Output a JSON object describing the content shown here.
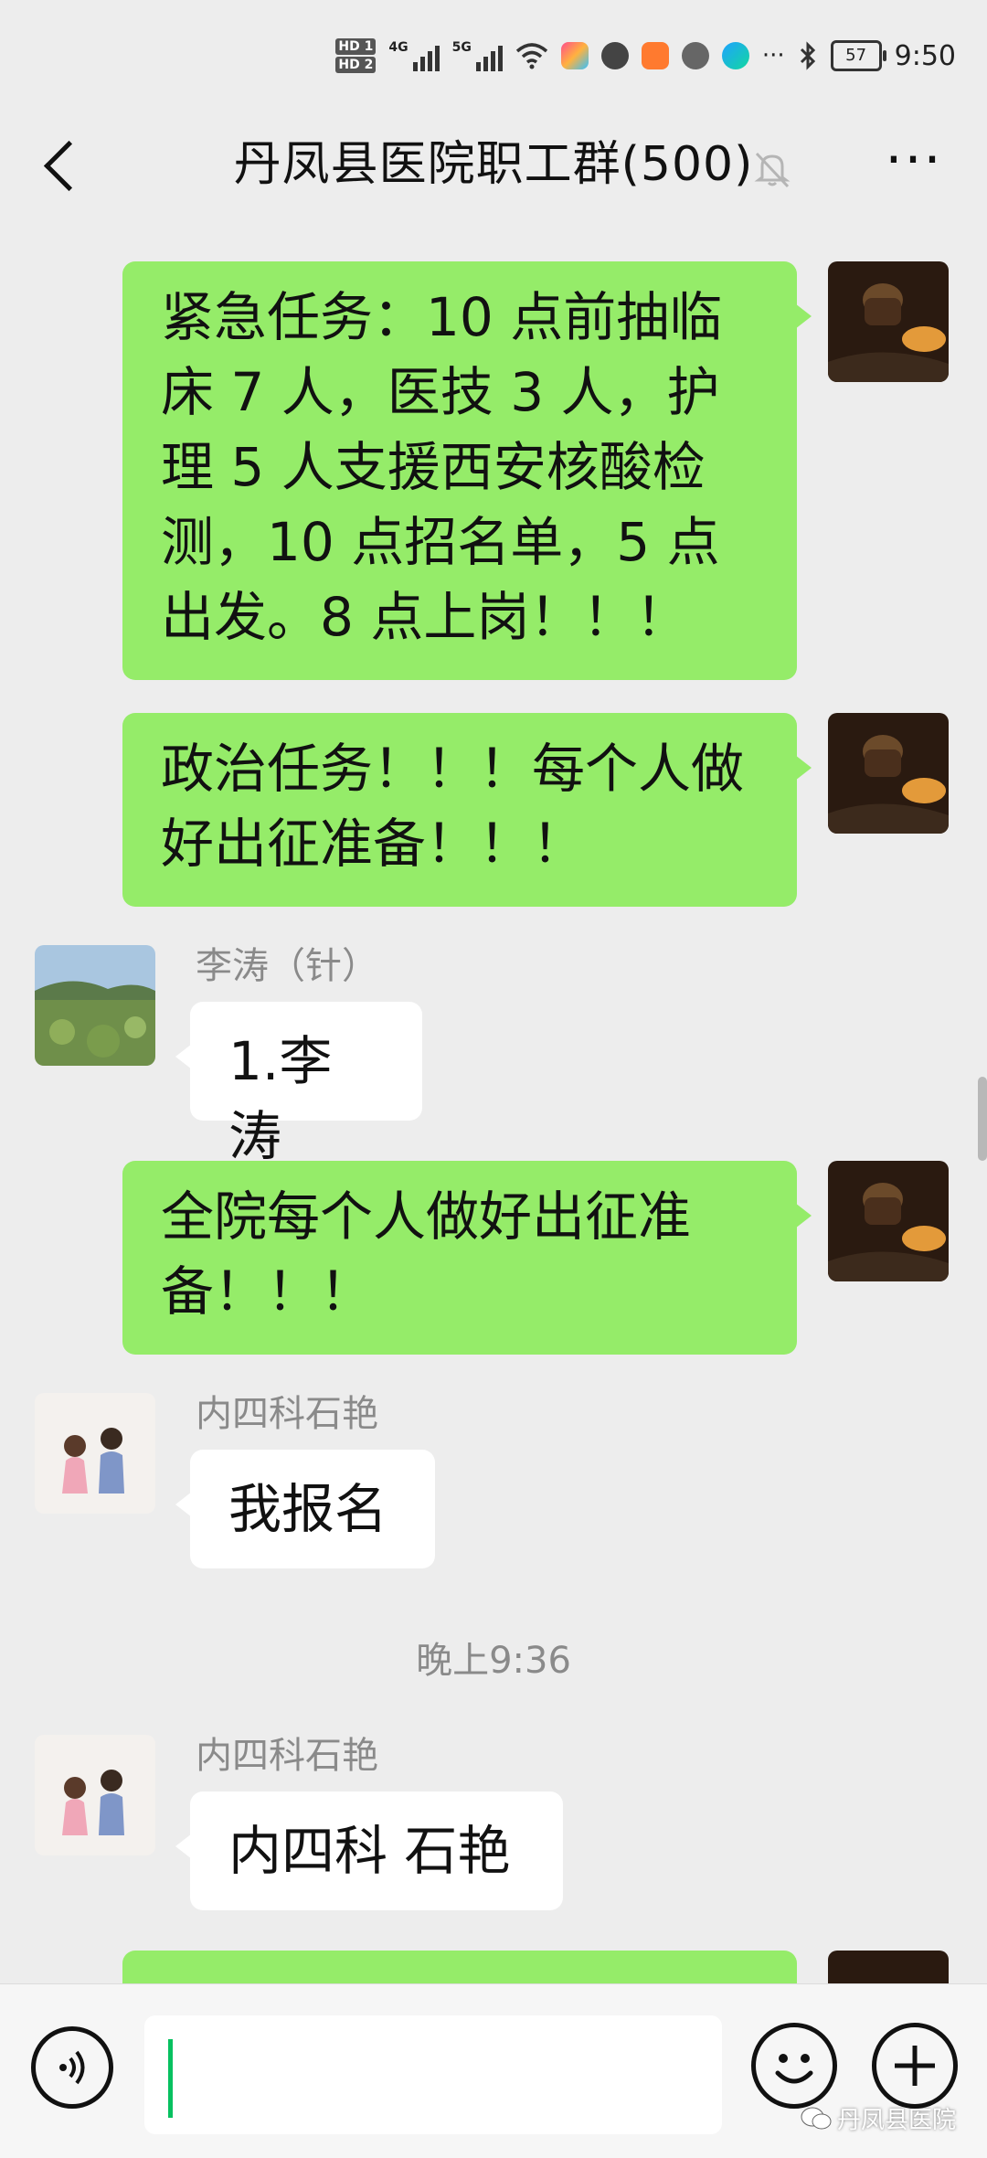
{
  "status_bar": {
    "hd1": "HD 1",
    "hd2": "HD 2",
    "net1": "4G",
    "net2": "5G",
    "more_glyph": "···",
    "battery": "57",
    "time": "9:50"
  },
  "header": {
    "back_icon": "chevron-left-icon",
    "title": "丹凤县医院职工群(500)",
    "mute_icon": "bell-off-icon",
    "more_label": "···"
  },
  "messages": [
    {
      "side": "right",
      "text": "紧急任务：10 点前抽临床 7 人，医技 3 人，护理 5 人支援西安核酸检测，10 点招名单，5 点出发。8 点上岗！！！"
    },
    {
      "side": "right",
      "text": "政治任务！！！每个人做好出征准备！！！"
    },
    {
      "side": "left",
      "sender": "李涛（针）",
      "text": "1.李涛"
    },
    {
      "side": "right",
      "text": "全院每个人做好出征准备！！！"
    },
    {
      "side": "left",
      "sender": "内四科石艳",
      "text": "我报名"
    },
    {
      "side": "left",
      "sender": "内四科石艳",
      "text": "内四科 石艳"
    }
  ],
  "timestamp": "晚上9:36",
  "input_bar": {
    "voice_icon": "voice-icon",
    "input_value": "",
    "emoji_icon": "emoji-icon",
    "plus_icon": "plus-icon",
    "watermark": "丹凤县医院"
  },
  "colors": {
    "background": "#ededed",
    "bubble_self": "#95ec69",
    "bubble_other": "#ffffff",
    "accent": "#07c160"
  }
}
